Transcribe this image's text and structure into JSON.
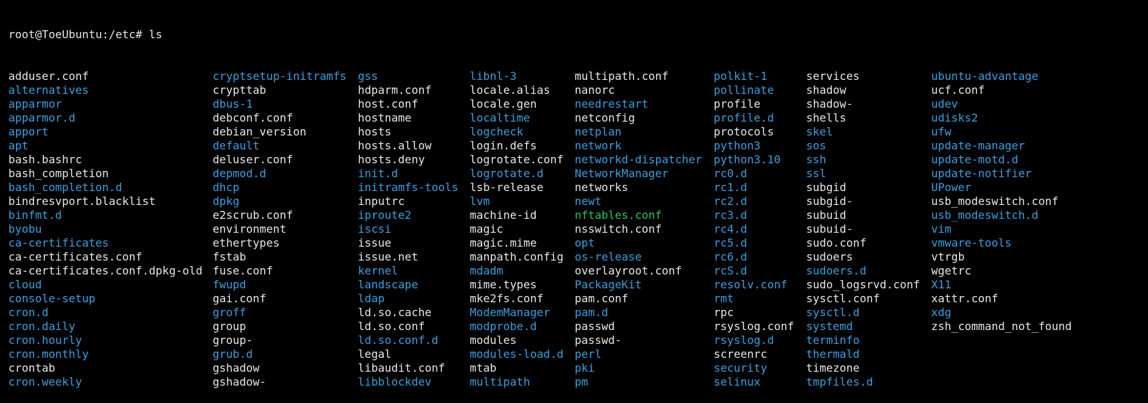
{
  "terminal": {
    "prompt": "root@ToeUbuntu:/etc#",
    "command": "ls"
  },
  "colors": {
    "background": "#000000",
    "file": "#e8e8e8",
    "directory": "#3aa0e0",
    "executable": "#23c56a"
  },
  "columns": [
    [
      {
        "name": "adduser.conf",
        "type": "file"
      },
      {
        "name": "alternatives",
        "type": "dir"
      },
      {
        "name": "apparmor",
        "type": "dir"
      },
      {
        "name": "apparmor.d",
        "type": "dir"
      },
      {
        "name": "apport",
        "type": "dir"
      },
      {
        "name": "apt",
        "type": "dir"
      },
      {
        "name": "bash.bashrc",
        "type": "file"
      },
      {
        "name": "bash_completion",
        "type": "file"
      },
      {
        "name": "bash_completion.d",
        "type": "dir"
      },
      {
        "name": "bindresvport.blacklist",
        "type": "file"
      },
      {
        "name": "binfmt.d",
        "type": "dir"
      },
      {
        "name": "byobu",
        "type": "dir"
      },
      {
        "name": "ca-certificates",
        "type": "dir"
      },
      {
        "name": "ca-certificates.conf",
        "type": "file"
      },
      {
        "name": "ca-certificates.conf.dpkg-old",
        "type": "file"
      },
      {
        "name": "cloud",
        "type": "dir"
      },
      {
        "name": "console-setup",
        "type": "dir"
      },
      {
        "name": "cron.d",
        "type": "dir"
      },
      {
        "name": "cron.daily",
        "type": "dir"
      },
      {
        "name": "cron.hourly",
        "type": "dir"
      },
      {
        "name": "cron.monthly",
        "type": "dir"
      },
      {
        "name": "crontab",
        "type": "file"
      },
      {
        "name": "cron.weekly",
        "type": "dir"
      }
    ],
    [
      {
        "name": "cryptsetup-initramfs",
        "type": "dir"
      },
      {
        "name": "crypttab",
        "type": "file"
      },
      {
        "name": "dbus-1",
        "type": "dir"
      },
      {
        "name": "debconf.conf",
        "type": "file"
      },
      {
        "name": "debian_version",
        "type": "file"
      },
      {
        "name": "default",
        "type": "dir"
      },
      {
        "name": "deluser.conf",
        "type": "file"
      },
      {
        "name": "depmod.d",
        "type": "dir"
      },
      {
        "name": "dhcp",
        "type": "dir"
      },
      {
        "name": "dpkg",
        "type": "dir"
      },
      {
        "name": "e2scrub.conf",
        "type": "file"
      },
      {
        "name": "environment",
        "type": "file"
      },
      {
        "name": "ethertypes",
        "type": "file"
      },
      {
        "name": "fstab",
        "type": "file"
      },
      {
        "name": "fuse.conf",
        "type": "file"
      },
      {
        "name": "fwupd",
        "type": "dir"
      },
      {
        "name": "gai.conf",
        "type": "file"
      },
      {
        "name": "groff",
        "type": "dir"
      },
      {
        "name": "group",
        "type": "file"
      },
      {
        "name": "group-",
        "type": "file"
      },
      {
        "name": "grub.d",
        "type": "dir"
      },
      {
        "name": "gshadow",
        "type": "file"
      },
      {
        "name": "gshadow-",
        "type": "file"
      }
    ],
    [
      {
        "name": "gss",
        "type": "dir"
      },
      {
        "name": "hdparm.conf",
        "type": "file"
      },
      {
        "name": "host.conf",
        "type": "file"
      },
      {
        "name": "hostname",
        "type": "file"
      },
      {
        "name": "hosts",
        "type": "file"
      },
      {
        "name": "hosts.allow",
        "type": "file"
      },
      {
        "name": "hosts.deny",
        "type": "file"
      },
      {
        "name": "init.d",
        "type": "dir"
      },
      {
        "name": "initramfs-tools",
        "type": "dir"
      },
      {
        "name": "inputrc",
        "type": "file"
      },
      {
        "name": "iproute2",
        "type": "dir"
      },
      {
        "name": "iscsi",
        "type": "dir"
      },
      {
        "name": "issue",
        "type": "file"
      },
      {
        "name": "issue.net",
        "type": "file"
      },
      {
        "name": "kernel",
        "type": "dir"
      },
      {
        "name": "landscape",
        "type": "dir"
      },
      {
        "name": "ldap",
        "type": "dir"
      },
      {
        "name": "ld.so.cache",
        "type": "file"
      },
      {
        "name": "ld.so.conf",
        "type": "file"
      },
      {
        "name": "ld.so.conf.d",
        "type": "dir"
      },
      {
        "name": "legal",
        "type": "file"
      },
      {
        "name": "libaudit.conf",
        "type": "file"
      },
      {
        "name": "libblockdev",
        "type": "dir"
      }
    ],
    [
      {
        "name": "libnl-3",
        "type": "dir"
      },
      {
        "name": "locale.alias",
        "type": "file"
      },
      {
        "name": "locale.gen",
        "type": "file"
      },
      {
        "name": "localtime",
        "type": "dir"
      },
      {
        "name": "logcheck",
        "type": "dir"
      },
      {
        "name": "login.defs",
        "type": "file"
      },
      {
        "name": "logrotate.conf",
        "type": "file"
      },
      {
        "name": "logrotate.d",
        "type": "dir"
      },
      {
        "name": "lsb-release",
        "type": "file"
      },
      {
        "name": "lvm",
        "type": "dir"
      },
      {
        "name": "machine-id",
        "type": "file"
      },
      {
        "name": "magic",
        "type": "file"
      },
      {
        "name": "magic.mime",
        "type": "file"
      },
      {
        "name": "manpath.config",
        "type": "file"
      },
      {
        "name": "mdadm",
        "type": "dir"
      },
      {
        "name": "mime.types",
        "type": "file"
      },
      {
        "name": "mke2fs.conf",
        "type": "file"
      },
      {
        "name": "ModemManager",
        "type": "dir"
      },
      {
        "name": "modprobe.d",
        "type": "dir"
      },
      {
        "name": "modules",
        "type": "file"
      },
      {
        "name": "modules-load.d",
        "type": "dir"
      },
      {
        "name": "mtab",
        "type": "file"
      },
      {
        "name": "multipath",
        "type": "dir"
      }
    ],
    [
      {
        "name": "multipath.conf",
        "type": "file"
      },
      {
        "name": "nanorc",
        "type": "file"
      },
      {
        "name": "needrestart",
        "type": "dir"
      },
      {
        "name": "netconfig",
        "type": "file"
      },
      {
        "name": "netplan",
        "type": "dir"
      },
      {
        "name": "network",
        "type": "dir"
      },
      {
        "name": "networkd-dispatcher",
        "type": "dir"
      },
      {
        "name": "NetworkManager",
        "type": "dir"
      },
      {
        "name": "networks",
        "type": "file"
      },
      {
        "name": "newt",
        "type": "dir"
      },
      {
        "name": "nftables.conf",
        "type": "exec"
      },
      {
        "name": "nsswitch.conf",
        "type": "file"
      },
      {
        "name": "opt",
        "type": "dir"
      },
      {
        "name": "os-release",
        "type": "dir"
      },
      {
        "name": "overlayroot.conf",
        "type": "file"
      },
      {
        "name": "PackageKit",
        "type": "dir"
      },
      {
        "name": "pam.conf",
        "type": "file"
      },
      {
        "name": "pam.d",
        "type": "dir"
      },
      {
        "name": "passwd",
        "type": "file"
      },
      {
        "name": "passwd-",
        "type": "file"
      },
      {
        "name": "perl",
        "type": "dir"
      },
      {
        "name": "pki",
        "type": "dir"
      },
      {
        "name": "pm",
        "type": "dir"
      }
    ],
    [
      {
        "name": "polkit-1",
        "type": "dir"
      },
      {
        "name": "pollinate",
        "type": "dir"
      },
      {
        "name": "profile",
        "type": "file"
      },
      {
        "name": "profile.d",
        "type": "dir"
      },
      {
        "name": "protocols",
        "type": "file"
      },
      {
        "name": "python3",
        "type": "dir"
      },
      {
        "name": "python3.10",
        "type": "dir"
      },
      {
        "name": "rc0.d",
        "type": "dir"
      },
      {
        "name": "rc1.d",
        "type": "dir"
      },
      {
        "name": "rc2.d",
        "type": "dir"
      },
      {
        "name": "rc3.d",
        "type": "dir"
      },
      {
        "name": "rc4.d",
        "type": "dir"
      },
      {
        "name": "rc5.d",
        "type": "dir"
      },
      {
        "name": "rc6.d",
        "type": "dir"
      },
      {
        "name": "rcS.d",
        "type": "dir"
      },
      {
        "name": "resolv.conf",
        "type": "dir"
      },
      {
        "name": "rmt",
        "type": "dir"
      },
      {
        "name": "rpc",
        "type": "file"
      },
      {
        "name": "rsyslog.conf",
        "type": "file"
      },
      {
        "name": "rsyslog.d",
        "type": "dir"
      },
      {
        "name": "screenrc",
        "type": "file"
      },
      {
        "name": "security",
        "type": "dir"
      },
      {
        "name": "selinux",
        "type": "dir"
      }
    ],
    [
      {
        "name": "services",
        "type": "file"
      },
      {
        "name": "shadow",
        "type": "file"
      },
      {
        "name": "shadow-",
        "type": "file"
      },
      {
        "name": "shells",
        "type": "file"
      },
      {
        "name": "skel",
        "type": "dir"
      },
      {
        "name": "sos",
        "type": "dir"
      },
      {
        "name": "ssh",
        "type": "dir"
      },
      {
        "name": "ssl",
        "type": "dir"
      },
      {
        "name": "subgid",
        "type": "file"
      },
      {
        "name": "subgid-",
        "type": "file"
      },
      {
        "name": "subuid",
        "type": "file"
      },
      {
        "name": "subuid-",
        "type": "file"
      },
      {
        "name": "sudo.conf",
        "type": "file"
      },
      {
        "name": "sudoers",
        "type": "file"
      },
      {
        "name": "sudoers.d",
        "type": "dir"
      },
      {
        "name": "sudo_logsrvd.conf",
        "type": "file"
      },
      {
        "name": "sysctl.conf",
        "type": "file"
      },
      {
        "name": "sysctl.d",
        "type": "dir"
      },
      {
        "name": "systemd",
        "type": "dir"
      },
      {
        "name": "terminfo",
        "type": "dir"
      },
      {
        "name": "thermald",
        "type": "dir"
      },
      {
        "name": "timezone",
        "type": "file"
      },
      {
        "name": "tmpfiles.d",
        "type": "dir"
      }
    ],
    [
      {
        "name": "ubuntu-advantage",
        "type": "dir"
      },
      {
        "name": "ucf.conf",
        "type": "file"
      },
      {
        "name": "udev",
        "type": "dir"
      },
      {
        "name": "udisks2",
        "type": "dir"
      },
      {
        "name": "ufw",
        "type": "dir"
      },
      {
        "name": "update-manager",
        "type": "dir"
      },
      {
        "name": "update-motd.d",
        "type": "dir"
      },
      {
        "name": "update-notifier",
        "type": "dir"
      },
      {
        "name": "UPower",
        "type": "dir"
      },
      {
        "name": "usb_modeswitch.conf",
        "type": "file"
      },
      {
        "name": "usb_modeswitch.d",
        "type": "dir"
      },
      {
        "name": "vim",
        "type": "dir"
      },
      {
        "name": "vmware-tools",
        "type": "dir"
      },
      {
        "name": "vtrgb",
        "type": "file"
      },
      {
        "name": "wgetrc",
        "type": "file"
      },
      {
        "name": "X11",
        "type": "dir"
      },
      {
        "name": "xattr.conf",
        "type": "file"
      },
      {
        "name": "xdg",
        "type": "dir"
      },
      {
        "name": "zsh_command_not_found",
        "type": "file"
      }
    ]
  ]
}
